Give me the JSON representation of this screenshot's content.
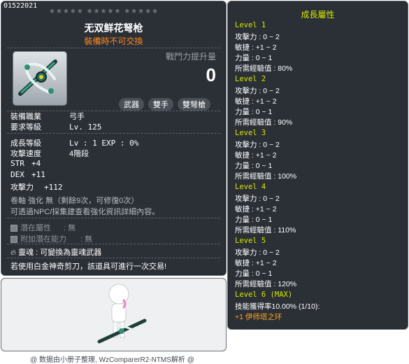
{
  "item": {
    "id": "01522021",
    "stars": "★★★★★  ★★★★★  ★★★★★",
    "name": "无双鲜花弩枪",
    "trade_note": "裝備時不可交換",
    "power_label": "戰鬥力提升量",
    "power_value": "0",
    "tags": [
      "武器",
      "雙手",
      "雙弩槍"
    ],
    "job_label": "裝備職業",
    "job_value": "弓手",
    "req_level_label": "要求等級",
    "req_level_value": "Lv. 125",
    "growth_label": "成長等級",
    "growth_value": "Lv : 1   EXP : 0%",
    "attack_speed_label": "攻擊速度",
    "attack_speed_value": "4階段",
    "str_label": "STR",
    "str_value": "+4",
    "dex_label": "DEX",
    "dex_value": "+11",
    "atk_label": "攻擊力",
    "atk_value": "+112",
    "enhance_line": "卷軸 強化 無（剩餘9次，可修復0次）",
    "enhance_hint": "可透過NPC/採集建查看強化資訊詳細內容。",
    "potential_label": "潛在屬性",
    "potential_value": "無",
    "add_potential_label": "附加潛在能力",
    "add_potential_value": "無",
    "soul_label": "靈魂",
    "soul_value": "可變換為靈魂武器",
    "scissors_note": "若使用白金神奇剪刀，該道具可進行一次交易!"
  },
  "growth": {
    "title": "成長屬性",
    "levels": [
      {
        "label": "Level 1",
        "atk": "攻擊力 : 0 ~ 2",
        "dex": "敏捷 : +1 ~ 2",
        "str": "力量 : 0 ~ 1",
        "exp": "所需經驗值 : 80%"
      },
      {
        "label": "Level 2",
        "atk": "攻擊力 : 0 ~ 2",
        "dex": "敏捷 : +1 ~ 2",
        "str": "力量 : 0 ~ 1",
        "exp": "所需經驗值 : 90%"
      },
      {
        "label": "Level 3",
        "atk": "攻擊力 : 0 ~ 2",
        "dex": "敏捷 : +1 ~ 2",
        "str": "力量 : 0 ~ 1",
        "exp": "所需經驗值 : 100%"
      },
      {
        "label": "Level 4",
        "atk": "攻擊力 : 0 ~ 2",
        "dex": "敏捷 : +1 ~ 2",
        "str": "力量 : 0 ~ 1",
        "exp": "所需經驗值 : 110%"
      },
      {
        "label": "Level 5",
        "atk": "攻擊力 : 0 ~ 2",
        "dex": "敏捷 : +1 ~ 2",
        "str": "力量 : 0 ~ 1",
        "exp": "所需經驗值 : 120%"
      }
    ],
    "max_label": "Level 6 (MAX)",
    "max_skill": "技能獲得率10.00% (1/10):",
    "max_reward": "+1 伊师塔之环"
  },
  "footer": {
    "credit": "@ 数据由小册子整理, WzComparerR2-NTMS解析 @"
  },
  "colors": {
    "panel_bg": "#2b3037",
    "accent_yellow": "#d6e600",
    "accent_orange": "#ff8a1f"
  }
}
